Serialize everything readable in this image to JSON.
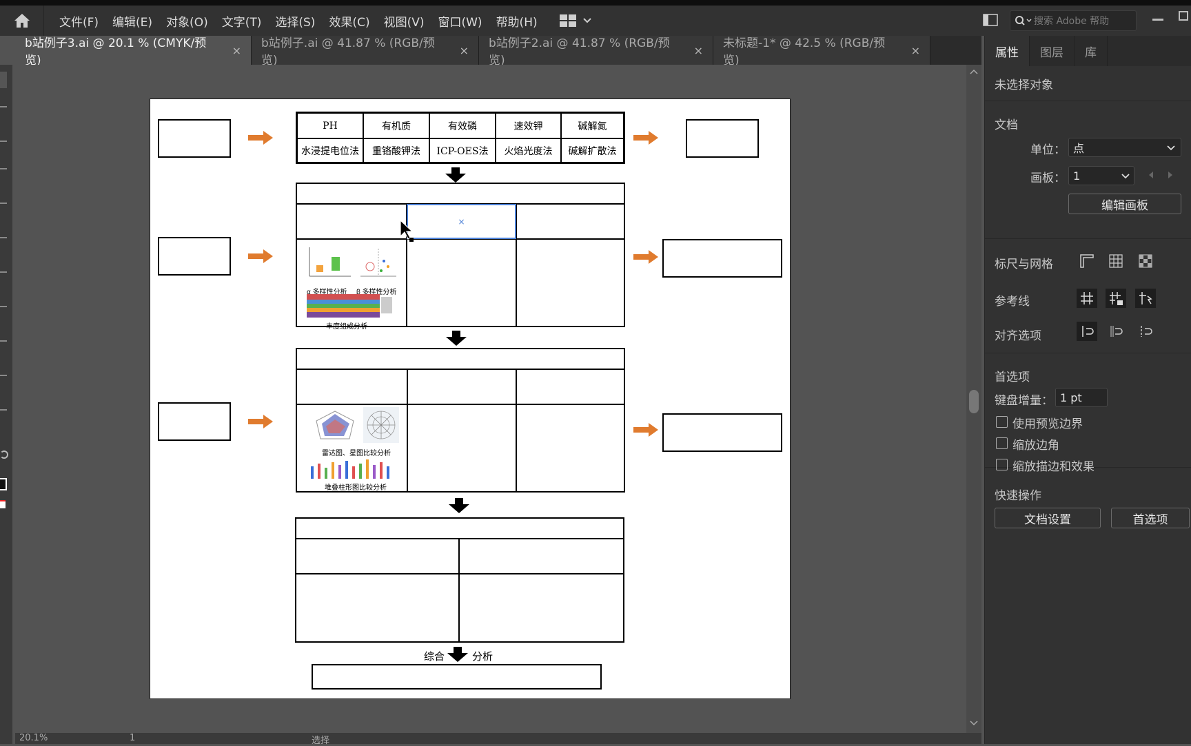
{
  "menubar": {
    "items": [
      "文件(F)",
      "编辑(E)",
      "对象(O)",
      "文字(T)",
      "选择(S)",
      "效果(C)",
      "视图(V)",
      "窗口(W)",
      "帮助(H)"
    ],
    "search_placeholder": "搜索 Adobe 帮助"
  },
  "tabs": [
    {
      "label": "b站例子3.ai @ 20.1 % (CMYK/预览)",
      "close": "×",
      "active": true
    },
    {
      "label": "b站例子.ai @ 41.87 % (RGB/预览)",
      "close": "×"
    },
    {
      "label": "b站例子2.ai @ 41.87 % (RGB/预览)",
      "close": "×"
    },
    {
      "label": "未标题-1* @ 42.5 % (RGB/预览)",
      "close": "×"
    }
  ],
  "artboard": {
    "soil_headers": [
      "PH",
      "有机质",
      "有效磷",
      "速效钾",
      "碱解氮"
    ],
    "soil_methods": [
      "水浸提电位法",
      "重铬酸钾法",
      "ICP-OES法",
      "火焰光度法",
      "碱解扩散法"
    ],
    "captions": {
      "alpha": "α 多样性分析",
      "beta": "β 多样性分析",
      "abundance": "丰度组成分析",
      "radar": "雷达图、星图比较分析",
      "stacked": "堆叠柱形图比较分析"
    },
    "final_left": "综合",
    "final_right": "分析",
    "selected_mark": "×"
  },
  "status": {
    "zoom": "20.1%",
    "page": "1",
    "tool": "选择"
  },
  "panel": {
    "tabs": [
      "属性",
      "图层",
      "库"
    ],
    "no_selection": "未选择对象",
    "document_title": "文档",
    "unit_label": "单位：",
    "unit_value": "点",
    "artboard_label": "画板：",
    "artboard_value": "1",
    "edit_artboard": "编辑画板",
    "rulers_grid": "标尺与网格",
    "guides": "参考线",
    "align_options": "对齐选项",
    "preferences_title": "首选项",
    "keyboard_increment_label": "键盘增量：",
    "keyboard_increment_value": "1 pt",
    "checkboxes": [
      "使用预览边界",
      "缩放边角",
      "缩放描边和效果"
    ],
    "quick_actions": "快速操作",
    "doc_setup": "文档设置",
    "preferences_btn": "首选项"
  }
}
